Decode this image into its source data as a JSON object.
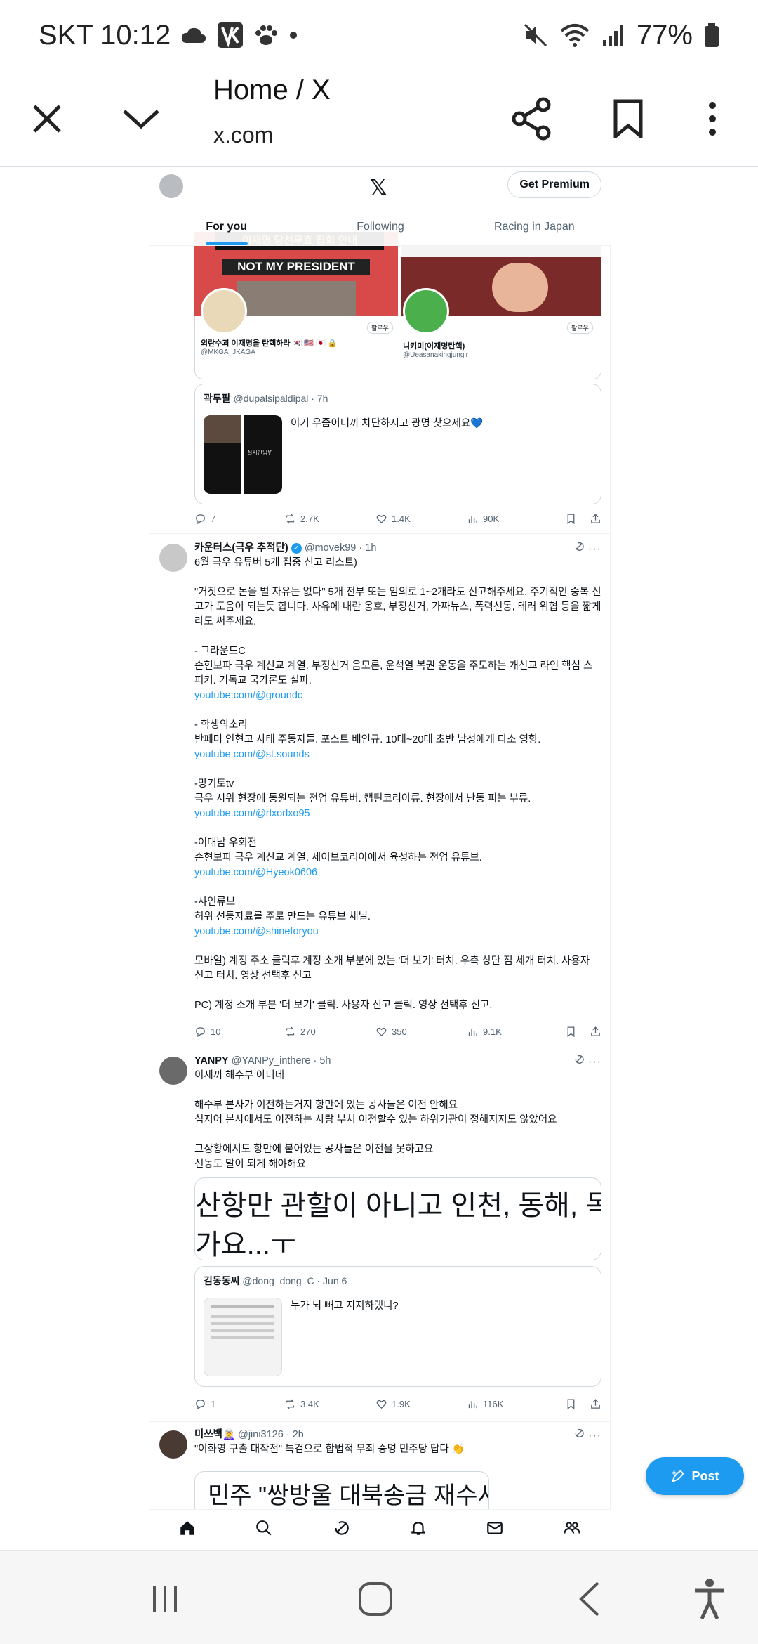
{
  "status_bar": {
    "carrier_time": "SKT 10:12",
    "battery": "77%"
  },
  "browser": {
    "title": "Home / X",
    "url": "x.com",
    "icons": [
      "close-icon",
      "chevron-down-icon",
      "share-icon",
      "bookmark-icon",
      "more-vert-icon"
    ]
  },
  "x_header": {
    "logo": "𝕏",
    "premium_label": "Get Premium",
    "tabs": [
      "For you",
      "Following",
      "Racing in Japan"
    ],
    "active_tab": "For you"
  },
  "post1": {
    "embedded_banner_top": "이재명 당선무효 집회 안내",
    "embedded_banner": "NOT MY PRESIDENT",
    "card_left_name": "외란수괴 이재명을 탄핵하라 🇰🇷 🇺🇸 🇯🇵 🔒",
    "card_left_handle": "@MKGA_JKAGA",
    "card_right_name": "니키미(이재명탄핵)",
    "card_right_handle": "@Ueasanakingjungjr",
    "card_follow": "팔로우",
    "quote_name": "곽두팔",
    "quote_handle": "@dupalsipaldipal",
    "quote_time": "· 7h",
    "quote_text": "이거 우좀이니까 차단하시고 광명 찾으세요💙",
    "quote_thumb_text": "실시간답변",
    "stats": {
      "replies": "7",
      "reposts": "2.7K",
      "likes": "1.4K",
      "views": "90K"
    }
  },
  "post2": {
    "name": "카운터스(극우 추적단)",
    "handle": "@movek99",
    "time": "· 1h",
    "lines": [
      "6월 극우 유튜버 5개 집중 신고 리스트)",
      "",
      "\"거짓으로 돈을 벌 자유는 없다\" 5개 전부 또는 임의로 1~2개라도 신고해주세요. 주기적인 중복 신고가 도움이 되는듯 합니다. 사유에 내란 옹호, 부정선거, 가짜뉴스, 폭력선동, 테러 위협 등을 짧게라도 써주세요.",
      "",
      "- 그라운드C",
      "손현보파 극우 계신교 계열. 부정선거 음모론, 윤석열 복권 운동을 주도하는 개신교 라인 핵심 스피커. 기독교 국가론도 설파."
    ],
    "link1": "youtube.com/@groundc",
    "sec2_title": "- 학생의소리",
    "sec2_text": "반페미 인현고 사태 주동자들. 포스트 배인규. 10대~20대 초반 남성에게 다소 영향.",
    "link2": "youtube.com/@st.sounds",
    "sec3_title": "-망기토tv",
    "sec3_text": "극우 시위 현장에 동원되는 전업 유튜버. 캡틴코리아류. 현장에서 난동 피는 부류.",
    "link3": "youtube.com/@rlxorlxo95",
    "sec4_title": "-이대남 우회전",
    "sec4_text": "손현보파 극우 계신교 계열. 세이브코리아에서 육성하는 전업 유튜브.",
    "link4": "youtube.com/@Hyeok0606",
    "sec5_title": "-샤인류브",
    "sec5_text": "허위 선동자료를 주로 만드는 유튜브 채널.",
    "link5": "youtube.com/@shineforyou",
    "mobile_text": "모바일) 계정 주소 클릭후 계정 소개 부분에 있는 '더 보기' 터치. 우측 상단 점 세개 터치. 사용자 신고 터치. 영상 선택후 신고",
    "pc_text": "PC) 계정 소개 부분 '더 보기' 클릭. 사용자 신고 클릭. 영상 선택후 신고.",
    "stats": {
      "replies": "10",
      "reposts": "270",
      "likes": "350",
      "views": "9.1K"
    }
  },
  "post3": {
    "name": "YANPY",
    "handle": "@YANPy_inthere",
    "time": "· 5h",
    "lines": [
      "이새끼 해수부 아니네",
      "",
      "해수부 본사가 이전하는거지 항만에 있는 공사들은 이전 안해요",
      "심지어 본사에서도 이전하는 사람 부처 이전할수 있는 하위기관이 정해지지도 않았어요",
      "",
      "그상황에서도 항만에 붙어있는 공사들은 이전을 못하고요",
      "선동도 말이 되게 해야해요"
    ],
    "image_line1": "산항만 관할이 아니고 인천, 동해, 목포",
    "image_line2": "가요...ㅜ",
    "quote_name": "김동동씨",
    "quote_handle": "@dong_dong_C",
    "quote_time": "· Jun 6",
    "quote_text": "누가 뇌 빼고 지지하랬니?",
    "stats": {
      "replies": "1",
      "reposts": "3.4K",
      "likes": "1.9K",
      "views": "116K"
    }
  },
  "post4": {
    "name": "미쓰백🧝‍♀️",
    "handle": "@jini3126",
    "time": "· 2h",
    "text": "\"이화영 구출 대작전\" 특검으로 합법적 무죄 증명 민주당 답다 👏",
    "image_text": "민주 \"쌍방울 대북송금 재수사"
  },
  "post_button": "Post",
  "bottom_nav": [
    "home-icon",
    "search-icon",
    "grok-icon",
    "notifications-icon",
    "messages-icon",
    "communities-icon"
  ],
  "system_nav": [
    "recents-icon",
    "home-circle-icon",
    "back-icon",
    "accessibility-icon"
  ]
}
